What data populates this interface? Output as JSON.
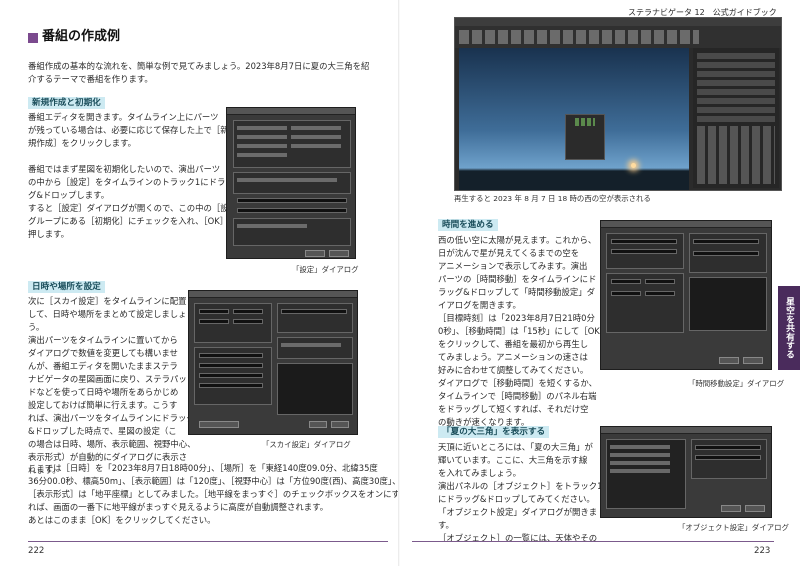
{
  "header": {
    "right_title": "ステラナビゲータ 12　公式ガイドブック"
  },
  "left": {
    "section_title": "番組の作成例",
    "intro": [
      "番組作成の基本的な流れを、簡単な例で見てみましょう。2023年8月7日に夏の大三角を紹",
      "介するテーマで番組を作ります。"
    ],
    "sub1": "新規作成と初期化",
    "sub1_text": [
      "番組エディタを開きます。タイムライン上にパーツ",
      "が残っている場合は、必要に応じて保存した上で［新",
      "規作成］をクリックします。",
      "",
      "番組ではまず星図を初期化したいので、演出パーツ",
      "の中から［設定］をタイムラインのトラック1にドラッ",
      "グ&ドロップします。",
      "すると［設定］ダイアログが開くので、この中の［設定］",
      "グループにある［初期化］にチェックを入れ、［OK］を",
      "押します。"
    ],
    "caption1": "「設定」ダイアログ",
    "sub2": "日時や場所を設定",
    "sub2_text": [
      "次に［スカイ設定］をタイムラインに配置",
      "して、日時や場所をまとめて設定しましょ",
      "う。",
      "演出パーツをタイムラインに置いてから",
      "ダイアログで数値を変更しても構いませ",
      "んが、番組エディタを開いたままステラ",
      "ナビゲータの星図画面に戻り、ステラパッ",
      "ドなどを使って日時や場所をあらかじめ",
      "設定しておけば簡単に行えます。こうす",
      "れば、演出パーツをタイムラインにドラッグ",
      "&ドロップした時点で、星図の設定（こ",
      "の場合は日時、場所、表示範囲、視野中心、",
      "表示形式）が自動的にダイアログに表示さ",
      "れます。"
    ],
    "caption2": "「スカイ設定」ダイアログ",
    "bottom_text": [
      "ここでは［日時］を「2023年8月7日18時00分」、［場所］を「東経140度09.0分、北緯35度",
      "36分00.0秒、標高50m」、［表示範囲］は「120度」、［視野中心］は「方位90度(西)、高度30度」、",
      "［表示形式］は「地平座標」としてみました。［地平線をまっすぐ］のチェックボックスをオンにす",
      "れば、画面の一番下に地平線がまっすぐ見えるように高度が自動調整されます。",
      "あとはこのまま［OK］をクリックしてください。"
    ],
    "page_number": "222"
  },
  "right": {
    "caption_top": "再生すると 2023 年 8 月 7 日 18 時の西の空が表示される",
    "sub3": "時間を進める",
    "sub3_text": [
      "西の低い空に太陽が見えます。これから、",
      "日が沈んで星が見えてくるまでの空を",
      "アニメーションで表示してみます。演出",
      "パーツの［時間移動］をタイムラインにド",
      "ラッグ&ドロップして「時間移動設定」ダ",
      "イアログを開きます。",
      "［目標時刻］は「2023年8月7日21時0分",
      "0秒」、［移動時間］は「15秒」にして［OK］",
      "をクリックして、番組を最初から再生し",
      "てみましょう。アニメーションの速さは",
      "好みに合わせて調整してみてください。",
      "ダイアログで［移動時間］を短くするか、",
      "タイムラインで［時間移動］のパネル右端",
      "をドラッグして短くすれば、それだけ空",
      "の動きが速くなります。"
    ],
    "caption3": "「時間移動設定」ダイアログ",
    "sub4": "「夏の大三角」を表示する",
    "sub4_text": [
      "天頂に近いところには、「夏の大三角」が",
      "輝いています。ここに、大三角を示す線",
      "を入れてみましょう。",
      "演出パネルの［オブジェクト］をトラック1",
      "にドラッグ&ドロップしてみてください。",
      "「オブジェクト設定」ダイアログが開きま",
      "す。",
      "［オブジェクト］の一覧には、天体やその"
    ],
    "caption4": "「オブジェクト設定」ダイアログ",
    "side_tab": "星空を共有する",
    "page_number": "223"
  },
  "colors": {
    "accent": "#7b4a8e",
    "subhead_bg": "#cdeaf2",
    "side_tab": "#4a2b5c"
  }
}
